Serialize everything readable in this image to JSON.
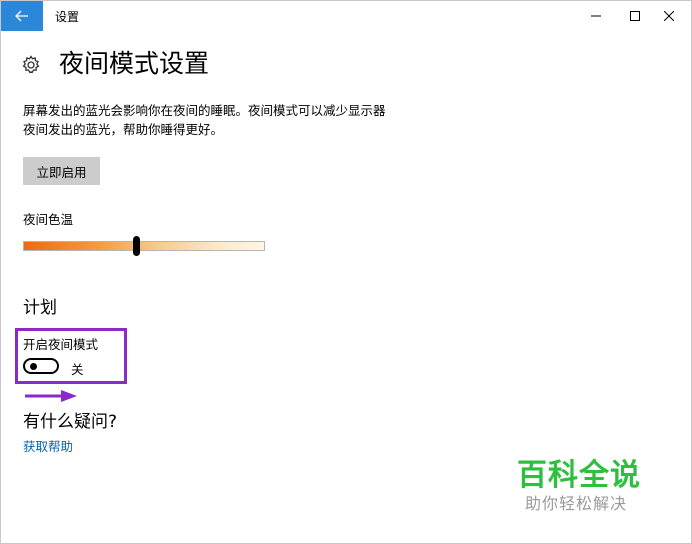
{
  "window": {
    "title": "设置"
  },
  "header": {
    "title": "夜间模式设置"
  },
  "description": {
    "line1": "屏幕发出的蓝光会影响你在夜间的睡眠。夜间模式可以减少显示器",
    "line2": "夜间发出的蓝光，帮助你睡得更好。"
  },
  "enable_button": {
    "label": "立即启用"
  },
  "color_temperature": {
    "label": "夜间色温",
    "level": 0.47
  },
  "schedule": {
    "heading": "计划",
    "toggle_label": "开启夜间模式",
    "toggle_state": "关",
    "toggle_on": false
  },
  "help": {
    "heading": "有什么疑问?",
    "link": "获取帮助"
  },
  "watermark": {
    "main": "百科全说",
    "sub": "助你轻松解决"
  },
  "colors": {
    "accent": "#2b88d8",
    "link": "#0063b1",
    "highlight": "#8a2bc8",
    "watermark": "#2fbf3f"
  },
  "icons": {
    "back": "back-arrow-icon",
    "minimize": "minimize-icon",
    "maximize": "maximize-icon",
    "close": "close-icon",
    "settings": "gear-icon",
    "annotation": "arrow-icon"
  }
}
